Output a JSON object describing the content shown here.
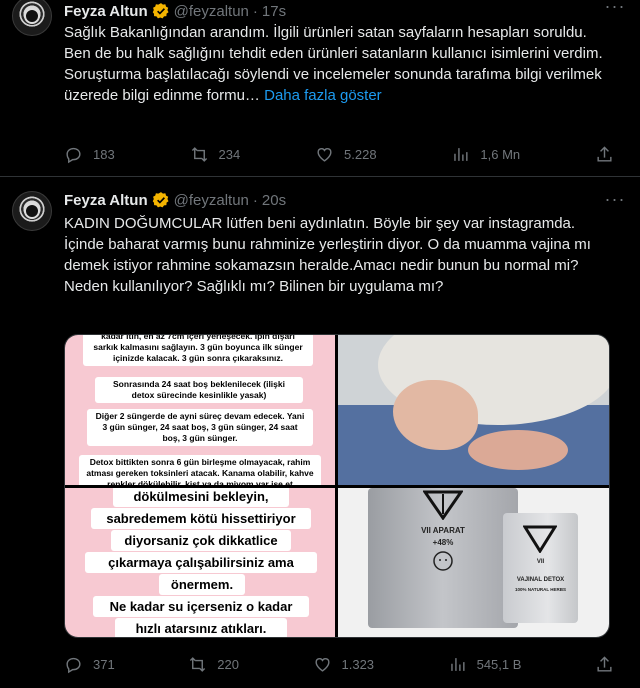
{
  "tweets": [
    {
      "name": "Feyza Altun",
      "handle": "@feyzaltun",
      "dot": "·",
      "time": "17s",
      "text": "Sağlık Bakanlığından arandım. İlgili ürünleri satan sayfaların hesapları soruldu. Ben de bu halk sağlığını tehdit eden ürünleri satanların kullanıcı isimlerini verdim. Soruşturma başlatılacağı söylendi ve incelemeler sonunda tarafıma bilgi verilmek üzerede bilgi edinme formu…",
      "show_more": "Daha fazla göster",
      "replies": "183",
      "reposts": "234",
      "likes": "5.228",
      "views": "1,6 Mn"
    },
    {
      "name": "Feyza Altun",
      "handle": "@feyzaltun",
      "dot": "·",
      "time": "20s",
      "text": "KADIN DOĞUMCULAR lütfen beni aydınlatın. Böyle bir şey var instagramda. İçinde baharat varmış bunu rahminize yerleştirin diyor. O da muamma vajina mı demek istiyor rahmine sokamazsın heralde.Amacı nedir bunun bu normal mi? Neden kullanılıyor? Sağlıklı mı? Bilinen bir uygulama mı?",
      "replies": "371",
      "reposts": "220",
      "likes": "1.323",
      "views": "545,1 B",
      "media": {
        "q1_lines": [
          "kadar itin, en az 7cm içeri yerleşecek. İpin dışarı sarkık kalmasını sağlayın. 3 gün boyunca ilk sünger içinizde kalacak. 3 gün sonra çıkaraksınız.",
          "Sonrasında 24 saat boş beklenilecek (ilişki detox sürecinde kesinlikle yasak)",
          "Diğer 2 süngerde de ayni süreç devam edecek. Yani 3 gün sünger, 24 saat boş, 3 gün sünger, 24 saat boş, 3 gün sünger.",
          "Detox bittikten sonra 6 gün birleşme olmayacak, rahim atması gereken toksinleri atacak. Kanama olabilir, kahve renkler dökülebilir, kist ya da miyom var ise et"
        ],
        "q3_lines": [
          "dökülmesini bekleyin,",
          "sabredemem kötü hissettiriyor",
          "diyorsaniz çok dikkatlice",
          "çıkarmaya çalışabilirsiniz ama",
          "önermem.",
          "Ne kadar su içerseniz o kadar",
          "hızlı atarsınız atıkları."
        ],
        "pouch_big": {
          "brand": "VII APARAT",
          "pct": "+48%"
        },
        "pouch_small": {
          "brand": "VII",
          "title": "VAJINAL DETOX",
          "sub": "100% NATURAL HERBS"
        }
      }
    }
  ],
  "colors": {
    "bg": "#000000",
    "text": "#e7e9ea",
    "muted": "#71767b",
    "link": "#1d9bf0",
    "verified": "#f4b400",
    "divider": "#2f3336"
  }
}
